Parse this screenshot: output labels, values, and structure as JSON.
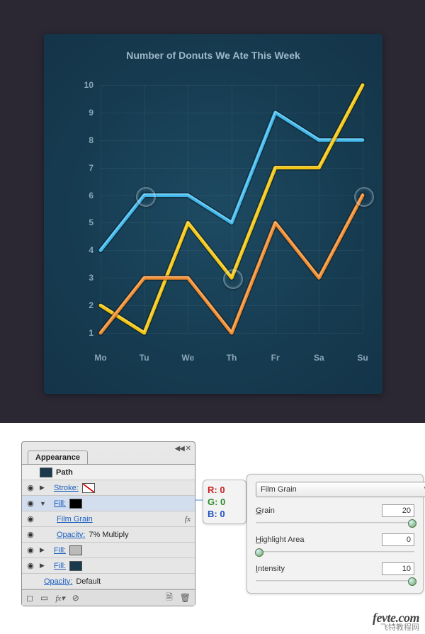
{
  "chart_data": {
    "type": "line",
    "title": "Number of Donuts We Ate This Week",
    "categories": [
      "Mo",
      "Tu",
      "We",
      "Th",
      "Fr",
      "Sa",
      "Su"
    ],
    "ylabel": "",
    "xlabel": "",
    "y_ticks": [
      10,
      9,
      8,
      7,
      6,
      5,
      4,
      3,
      2,
      1
    ],
    "ylim": [
      1,
      10
    ],
    "series": [
      {
        "name": "blue",
        "color": "#3eb7ec",
        "values": [
          4,
          6,
          6,
          5,
          9,
          8,
          8
        ]
      },
      {
        "name": "yellow",
        "color": "#f2c40e",
        "values": [
          2,
          1,
          5,
          3,
          7,
          7,
          10
        ]
      },
      {
        "name": "orange",
        "color": "#f08a2b",
        "values": [
          1,
          3,
          3,
          1,
          5,
          3,
          6
        ]
      }
    ],
    "highlight_rings": [
      {
        "series": "blue",
        "category": "Tu",
        "value": 6
      },
      {
        "series": "yellow",
        "category": "Th",
        "value": 3
      },
      {
        "series": "orange",
        "category": "Su",
        "value": 6
      }
    ]
  },
  "appearance_panel": {
    "tab": "Appearance",
    "header": "Path",
    "rows": {
      "stroke_label": "Stroke:",
      "fill_label": "Fill:",
      "film_grain": "Film Grain",
      "opacity_fill": "Opacity:",
      "opacity_fill_val": "7% Multiply",
      "fill2_label": "Fill:",
      "fill3_label": "Fill:",
      "opacity_obj": "Opacity:",
      "opacity_obj_val": "Default"
    }
  },
  "rgb": {
    "r": "R: 0",
    "g": "G: 0",
    "b": "B: 0"
  },
  "fx_panel": {
    "select": "Film Grain",
    "sliders": [
      {
        "label": "Grain",
        "value": "20",
        "pos": 0.98,
        "hl": "G"
      },
      {
        "label": "Highlight Area",
        "value": "0",
        "pos": 0.02,
        "hl": "H"
      },
      {
        "label": "Intensity",
        "value": "10",
        "pos": 0.98,
        "hl": "I"
      }
    ]
  },
  "watermark": {
    "line1": "fevte.com",
    "line2": "飞特教程网"
  }
}
